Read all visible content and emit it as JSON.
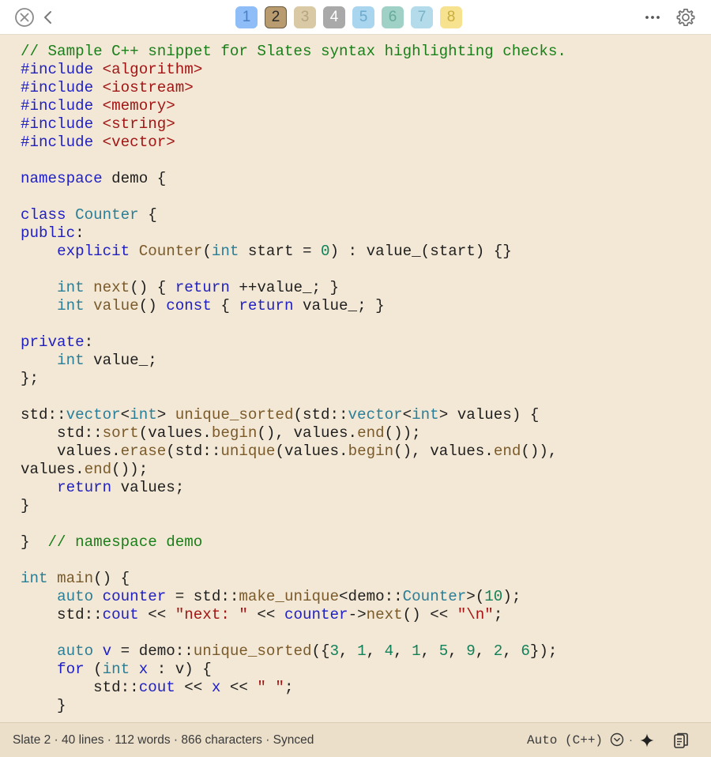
{
  "toolbar": {
    "tabs": [
      {
        "label": "1",
        "bg": "#8fbdf7",
        "fg": "#4a7fc4",
        "border": "#8fbdf7"
      },
      {
        "label": "2",
        "bg": "#b89c70",
        "fg": "#2a2a2a",
        "border": "#6b5a3e"
      },
      {
        "label": "3",
        "bg": "#d9c9a4",
        "fg": "#b7a57f",
        "border": "#d9c9a4"
      },
      {
        "label": "4",
        "bg": "#a9a9a9",
        "fg": "#ffffff",
        "border": "#a9a9a9"
      },
      {
        "label": "5",
        "bg": "#a9d6ee",
        "fg": "#6ca9cc",
        "border": "#a9d6ee"
      },
      {
        "label": "6",
        "bg": "#9fd1c6",
        "fg": "#66aa9c",
        "border": "#9fd1c6"
      },
      {
        "label": "7",
        "bg": "#b3dbea",
        "fg": "#78b3c9",
        "border": "#b3dbea"
      },
      {
        "label": "8",
        "bg": "#f7e290",
        "fg": "#c9ad3f",
        "border": "#f7e290"
      }
    ],
    "icons": {
      "close": "close-circle-icon",
      "back": "chevron-left-icon",
      "more": "ellipsis-icon",
      "settings": "gear-icon"
    }
  },
  "editor": {
    "background": "#f2e8d5",
    "lines": [
      [
        [
          "// Sample C++ snippet for Slates syntax highlighting checks.",
          "com"
        ]
      ],
      [
        [
          "#include ",
          "kw"
        ],
        [
          "<algorithm>",
          "str"
        ]
      ],
      [
        [
          "#include ",
          "kw"
        ],
        [
          "<iostream>",
          "str"
        ]
      ],
      [
        [
          "#include ",
          "kw"
        ],
        [
          "<memory>",
          "str"
        ]
      ],
      [
        [
          "#include ",
          "kw"
        ],
        [
          "<string>",
          "str"
        ]
      ],
      [
        [
          "#include ",
          "kw"
        ],
        [
          "<vector>",
          "str"
        ]
      ],
      [],
      [
        [
          "namespace",
          "kw"
        ],
        [
          " demo {",
          ""
        ]
      ],
      [],
      [
        [
          "class",
          "kw"
        ],
        [
          " ",
          ""
        ],
        [
          "Counter",
          "typ"
        ],
        [
          " {",
          ""
        ]
      ],
      [
        [
          "public",
          "kw"
        ],
        [
          ":",
          ""
        ]
      ],
      [
        [
          "    ",
          ""
        ],
        [
          "explicit",
          "kw"
        ],
        [
          " ",
          ""
        ],
        [
          "Counter",
          "fn"
        ],
        [
          "(",
          ""
        ],
        [
          "int",
          "typ"
        ],
        [
          " start = ",
          ""
        ],
        [
          "0",
          "num"
        ],
        [
          ") : value_(start) {}",
          ""
        ]
      ],
      [],
      [
        [
          "    ",
          ""
        ],
        [
          "int",
          "typ"
        ],
        [
          " ",
          ""
        ],
        [
          "next",
          "fn"
        ],
        [
          "() { ",
          ""
        ],
        [
          "return",
          "kw"
        ],
        [
          " ++value_; }",
          ""
        ]
      ],
      [
        [
          "    ",
          ""
        ],
        [
          "int",
          "typ"
        ],
        [
          " ",
          ""
        ],
        [
          "value",
          "fn"
        ],
        [
          "() ",
          ""
        ],
        [
          "const",
          "kw"
        ],
        [
          " { ",
          ""
        ],
        [
          "return",
          "kw"
        ],
        [
          " value_; }",
          ""
        ]
      ],
      [],
      [
        [
          "private",
          "kw"
        ],
        [
          ":",
          ""
        ]
      ],
      [
        [
          "    ",
          ""
        ],
        [
          "int",
          "typ"
        ],
        [
          " value_;",
          ""
        ]
      ],
      [
        [
          "};",
          ""
        ]
      ],
      [],
      [
        [
          "std::",
          ""
        ],
        [
          "vector",
          "typ"
        ],
        [
          "<",
          ""
        ],
        [
          "int",
          "typ"
        ],
        [
          "> ",
          ""
        ],
        [
          "unique_sorted",
          "fn"
        ],
        [
          "(std::",
          ""
        ],
        [
          "vector",
          "typ"
        ],
        [
          "<",
          ""
        ],
        [
          "int",
          "typ"
        ],
        [
          "> values) {",
          ""
        ]
      ],
      [
        [
          "    std::",
          ""
        ],
        [
          "sort",
          "fn"
        ],
        [
          "(values.",
          ""
        ],
        [
          "begin",
          "fn"
        ],
        [
          "(), values.",
          ""
        ],
        [
          "end",
          "fn"
        ],
        [
          "());",
          ""
        ]
      ],
      [
        [
          "    values.",
          ""
        ],
        [
          "erase",
          "fn"
        ],
        [
          "(std::",
          ""
        ],
        [
          "unique",
          "fn"
        ],
        [
          "(values.",
          ""
        ],
        [
          "begin",
          "fn"
        ],
        [
          "(), values.",
          ""
        ],
        [
          "end",
          "fn"
        ],
        [
          "()),",
          ""
        ]
      ],
      [
        [
          "values.",
          ""
        ],
        [
          "end",
          "fn"
        ],
        [
          "());",
          ""
        ]
      ],
      [
        [
          "    ",
          ""
        ],
        [
          "return",
          "kw"
        ],
        [
          " values;",
          ""
        ]
      ],
      [
        [
          "}",
          ""
        ]
      ],
      [],
      [
        [
          "}  ",
          ""
        ],
        [
          "// namespace demo",
          "com"
        ]
      ],
      [],
      [
        [
          "int",
          "typ"
        ],
        [
          " ",
          ""
        ],
        [
          "main",
          "fn"
        ],
        [
          "() {",
          ""
        ]
      ],
      [
        [
          "    ",
          ""
        ],
        [
          "auto",
          "typ"
        ],
        [
          " ",
          ""
        ],
        [
          "counter",
          "kw"
        ],
        [
          " = std::",
          ""
        ],
        [
          "make_unique",
          "fn"
        ],
        [
          "<demo::",
          ""
        ],
        [
          "Counter",
          "typ"
        ],
        [
          ">(",
          ""
        ],
        [
          "10",
          "num"
        ],
        [
          ");",
          ""
        ]
      ],
      [
        [
          "    std::",
          ""
        ],
        [
          "cout",
          "kw"
        ],
        [
          " << ",
          ""
        ],
        [
          "\"next: \"",
          "str"
        ],
        [
          " << ",
          ""
        ],
        [
          "counter",
          "kw"
        ],
        [
          "->",
          ""
        ],
        [
          "next",
          "fn"
        ],
        [
          "() << ",
          ""
        ],
        [
          "\"\\n\"",
          "str"
        ],
        [
          ";",
          ""
        ]
      ],
      [],
      [
        [
          "    ",
          ""
        ],
        [
          "auto",
          "typ"
        ],
        [
          " ",
          ""
        ],
        [
          "v",
          "kw"
        ],
        [
          " = demo::",
          ""
        ],
        [
          "unique_sorted",
          "fn"
        ],
        [
          "({",
          ""
        ],
        [
          "3",
          "num"
        ],
        [
          ", ",
          ""
        ],
        [
          "1",
          "num"
        ],
        [
          ", ",
          ""
        ],
        [
          "4",
          "num"
        ],
        [
          ", ",
          ""
        ],
        [
          "1",
          "num"
        ],
        [
          ", ",
          ""
        ],
        [
          "5",
          "num"
        ],
        [
          ", ",
          ""
        ],
        [
          "9",
          "num"
        ],
        [
          ", ",
          ""
        ],
        [
          "2",
          "num"
        ],
        [
          ", ",
          ""
        ],
        [
          "6",
          "num"
        ],
        [
          "});",
          ""
        ]
      ],
      [
        [
          "    ",
          ""
        ],
        [
          "for",
          "kw"
        ],
        [
          " (",
          ""
        ],
        [
          "int",
          "typ"
        ],
        [
          " ",
          ""
        ],
        [
          "x",
          "kw"
        ],
        [
          " : v) {",
          ""
        ]
      ],
      [
        [
          "        std::",
          ""
        ],
        [
          "cout",
          "kw"
        ],
        [
          " << ",
          ""
        ],
        [
          "x",
          "kw"
        ],
        [
          " << ",
          ""
        ],
        [
          "\" \"",
          "str"
        ],
        [
          ";",
          ""
        ]
      ],
      [
        [
          "    }",
          ""
        ]
      ]
    ]
  },
  "status": {
    "text": "Slate 2 · 40 lines · 112 words · 866 characters · Synced",
    "language": "Auto (C++)",
    "icons": {
      "language_menu": "chevron-down-circle-icon",
      "sparkle": "sparkle-icon",
      "copy": "copy-icon"
    }
  }
}
